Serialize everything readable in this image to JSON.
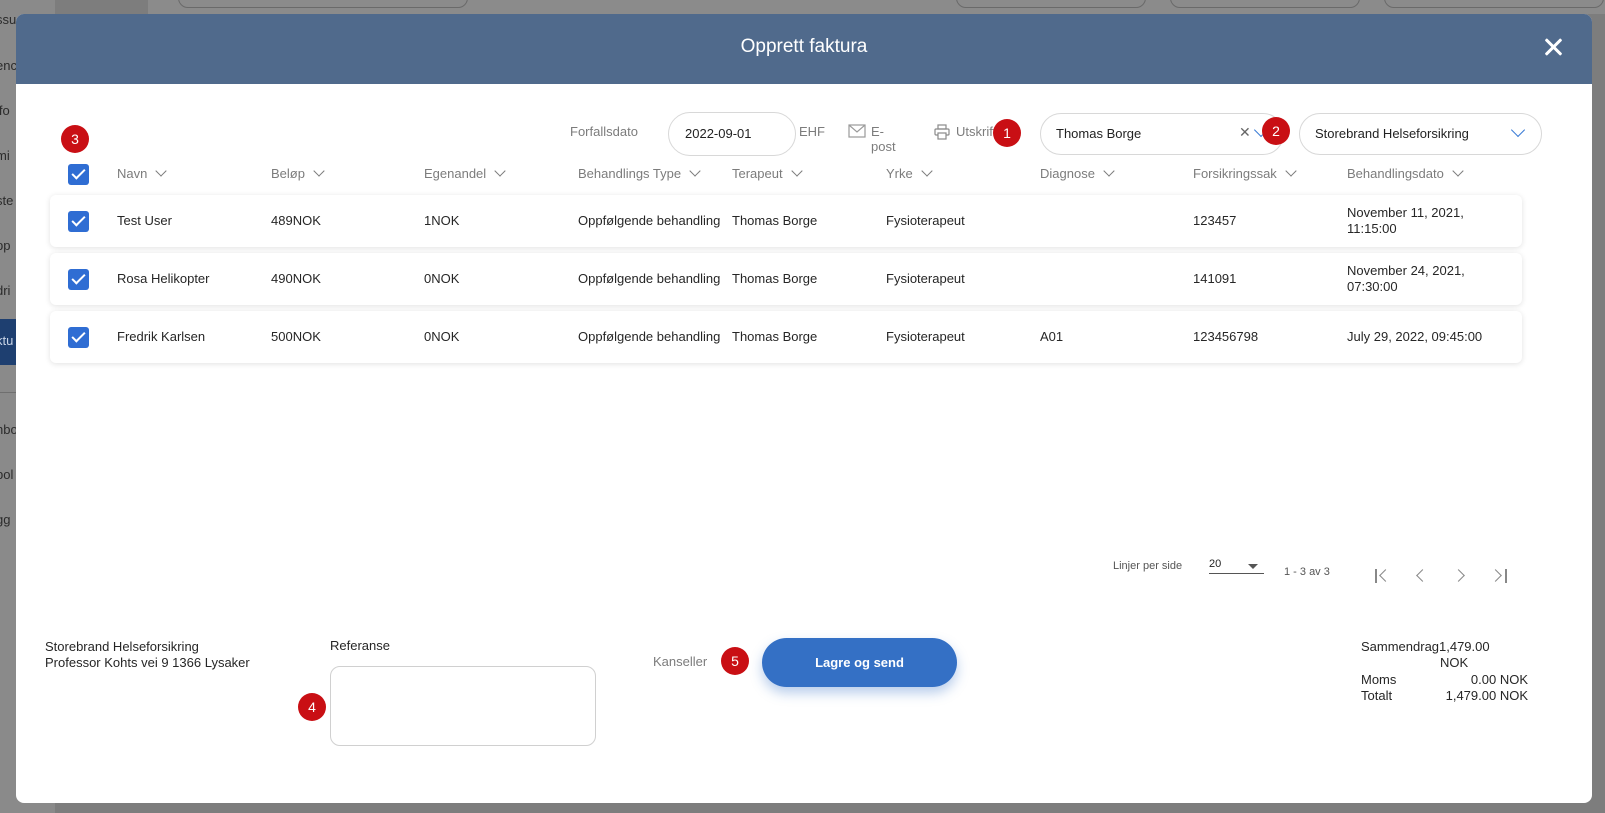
{
  "background": {
    "sidebar_items": [
      "ssu",
      "enc",
      "lfo",
      "mi",
      "ste",
      "pp",
      "dri",
      "ktu",
      "nbo",
      "bol",
      "gg"
    ]
  },
  "modal": {
    "title": "Opprett faktura"
  },
  "toolbar": {
    "due_date_label": "Forfallsdato",
    "due_date_value": "2022-09-01",
    "ehf_label": "EHF",
    "email_label": "E-post",
    "print_label": "Utskrift",
    "therapist_value": "Thomas Borge",
    "insurer_value": "Storebrand Helseforsikring"
  },
  "badges": [
    "1",
    "2",
    "3",
    "4",
    "5"
  ],
  "table": {
    "headers": [
      "Navn",
      "Beløp",
      "Egenandel",
      "Behandlings Type",
      "Terapeut",
      "Yrke",
      "Diagnose",
      "Forsikringssak",
      "Behandlingsdato"
    ],
    "rows": [
      {
        "navn": "Test User",
        "belop": "489NOK",
        "egenandel": "1NOK",
        "type": "Oppfølgende behandling",
        "terapeut": "Thomas Borge",
        "yrke": "Fysioterapeut",
        "diagnose": "",
        "sak": "123457",
        "dato": "November 11, 2021, 11:15:00"
      },
      {
        "navn": "Rosa Helikopter",
        "belop": "490NOK",
        "egenandel": "0NOK",
        "type": "Oppfølgende behandling",
        "terapeut": "Thomas Borge",
        "yrke": "Fysioterapeut",
        "diagnose": "",
        "sak": "141091",
        "dato": "November 24, 2021, 07:30:00"
      },
      {
        "navn": "Fredrik Karlsen",
        "belop": "500NOK",
        "egenandel": "0NOK",
        "type": "Oppfølgende behandling",
        "terapeut": "Thomas Borge",
        "yrke": "Fysioterapeut",
        "diagnose": "A01",
        "sak": "123456798",
        "dato": "July 29, 2022, 09:45:00"
      }
    ]
  },
  "pager": {
    "rows_per_page_label": "Linjer per side",
    "rows_per_page_value": "20",
    "range_text": "1 - 3 av 3"
  },
  "footer": {
    "recipient_name": "Storebrand Helseforsikring",
    "recipient_address": "Professor Kohts vei 9 1366 Lysaker",
    "reference_label": "Referanse",
    "reference_value": "",
    "cancel_label": "Kanseller",
    "submit_label": "Lagre og send"
  },
  "summary": {
    "summary_label": "Sammendrag",
    "summary_value": "1,479.00",
    "summary_unit": "NOK",
    "vat_label": "Moms",
    "vat_value": "0.00 NOK",
    "total_label": "Totalt",
    "total_value": "1,479.00 NOK"
  }
}
